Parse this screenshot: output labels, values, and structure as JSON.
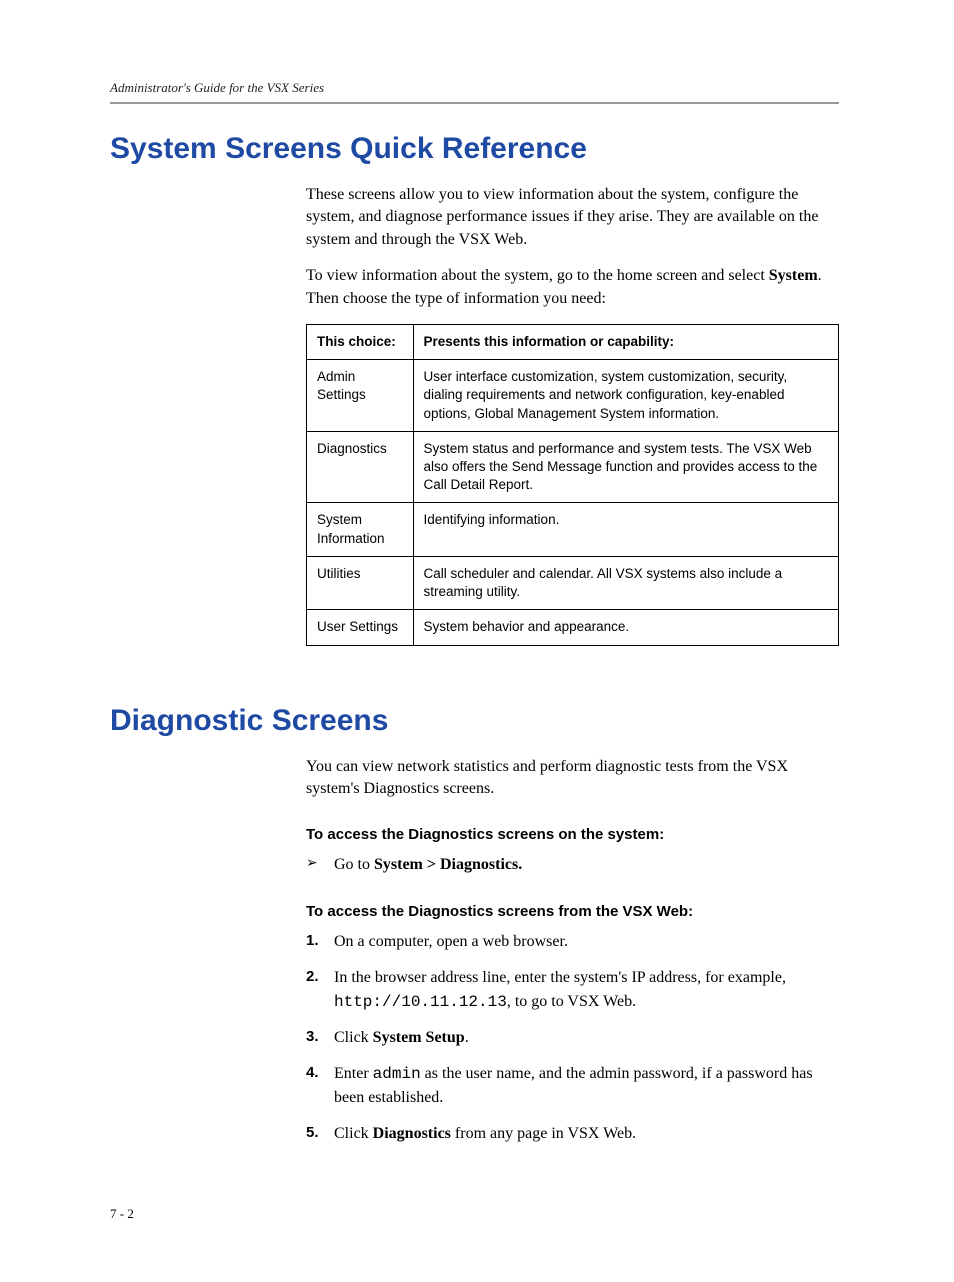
{
  "header": {
    "runningTitle": "Administrator's Guide for the VSX Series"
  },
  "section1": {
    "title": "System Screens Quick Reference",
    "para1": "These screens allow you to view information about the system, configure the system, and diagnose performance issues if they arise. They are available on the system and through the VSX Web.",
    "para2_a": "To view information about the system, go to the home screen and select ",
    "para2_bold": "System",
    "para2_b": ". Then choose the type of information you need:",
    "table": {
      "headers": {
        "col1": "This choice:",
        "col2": "Presents this information or capability:"
      },
      "rows": [
        {
          "c1": "Admin Settings",
          "c2": "User interface customization, system customization, security, dialing requirements and network configuration, key-enabled options, Global Management System information."
        },
        {
          "c1": "Diagnostics",
          "c2": "System status and performance and system tests. The VSX Web also offers the Send Message function and provides access to the Call Detail Report."
        },
        {
          "c1": "System Information",
          "c2": "Identifying information."
        },
        {
          "c1": "Utilities",
          "c2": "Call scheduler and calendar. All VSX systems also include a streaming utility."
        },
        {
          "c1": "User Settings",
          "c2": "System behavior and appearance."
        }
      ]
    }
  },
  "section2": {
    "title": "Diagnostic Screens",
    "para1": "You can view network statistics and perform diagnostic tests from the VSX system's Diagnostics screens.",
    "stepHead1": "To access the Diagnostics screens on the system:",
    "bullet1_a": "Go to ",
    "bullet1_bold": "System > Diagnostics.",
    "stepHead2": "To access the Diagnostics screens from the VSX Web:",
    "steps": {
      "s1": "On a computer, open a web browser.",
      "s2_a": "In the browser address line, enter the system's IP address, for example, ",
      "s2_code": "http://10.11.12.13",
      "s2_b": ", to go to VSX Web.",
      "s3_a": "Click ",
      "s3_bold": "System Setup",
      "s3_b": ".",
      "s4_a": "Enter ",
      "s4_code": "admin",
      "s4_b": " as the user name, and the admin password, if a password has been established.",
      "s5_a": "Click ",
      "s5_bold": "Diagnostics",
      "s5_b": " from any page in VSX Web."
    }
  },
  "footer": {
    "pageNumber": "7 - 2"
  },
  "glyphs": {
    "arrow": "➢"
  }
}
